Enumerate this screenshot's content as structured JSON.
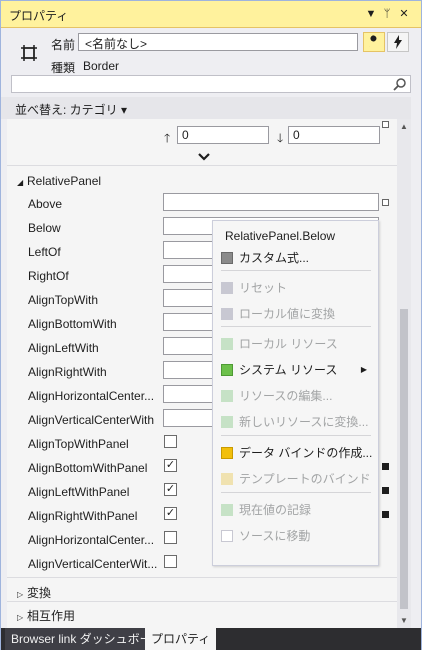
{
  "window": {
    "title": "プロパティ",
    "buttons": [
      "▼",
      "ᛘ",
      "✕"
    ]
  },
  "header": {
    "name_label": "名前",
    "name_value": "<名前なし>",
    "type_label": "種類",
    "type_value": "Border"
  },
  "search": {
    "value": "",
    "placeholder": ""
  },
  "sortbar": {
    "label": "並べ替え: カテゴリ ▾"
  },
  "top_fields": {
    "up_value": "0",
    "down_value": "0"
  },
  "section": {
    "title": "RelativePanel"
  },
  "rows": {
    "above": "Above",
    "below": "Below",
    "leftof": "LeftOf",
    "rightof": "RightOf",
    "aligntopwith": "AlignTopWith",
    "alignbottomwith": "AlignBottomWith",
    "alignleftwith": "AlignLeftWith",
    "alignrightwith": "AlignRightWith",
    "alignhcenter": "AlignHorizontalCenter...",
    "alignvcenter": "AlignVerticalCenterWith",
    "aligntoppanel": "AlignTopWithPanel",
    "alignbottompanel": "AlignBottomWithPanel",
    "alignleftpanel": "AlignLeftWithPanel",
    "alignrightpanel": "AlignRightWithPanel",
    "alignhcenterpanel": "AlignHorizontalCenter...",
    "alignvcenterpanel": "AlignVerticalCenterWit..."
  },
  "checks": {
    "aligntoppanel": "",
    "alignbottompanel": "✓",
    "alignleftpanel": "✓",
    "alignrightpanel": "✓",
    "alignhcenterpanel": "",
    "alignvcenterpanel": ""
  },
  "collapsed_sections": {
    "transform": "変換",
    "interaction": "相互作用"
  },
  "context_menu": {
    "title": "RelativePanel.Below",
    "items": {
      "custom": "カスタム式...",
      "reset": "リセット",
      "to_local": "ローカル値に変換",
      "local_resource": "ローカル リソース",
      "system_resource": "システム リソース",
      "edit_resource": "リソースの編集...",
      "new_resource": "新しいリソースに変換...",
      "data_binding": "データ バインドの作成...",
      "template_binding": "テンプレートのバインド",
      "record_value": "現在値の記録",
      "go_to_source": "ソースに移動"
    },
    "colors": {
      "custom": "#8a8a8a",
      "reset": "#c8c8d2",
      "to_local": "#c8c8d2",
      "local_resource": "#c6e2c6",
      "system_resource": "#6cc04a",
      "edit_resource": "#c6e2c6",
      "new_resource": "#c6e2c6",
      "data_binding": "#f2bf0b",
      "template_binding": "#f0e2b0",
      "record_value": "#c6e2c6",
      "go_to_source": "#ffffff"
    }
  },
  "tabs": {
    "browser_link": "Browser link ダッシュボード",
    "properties": "プロパティ"
  },
  "accent": "#fff29d"
}
